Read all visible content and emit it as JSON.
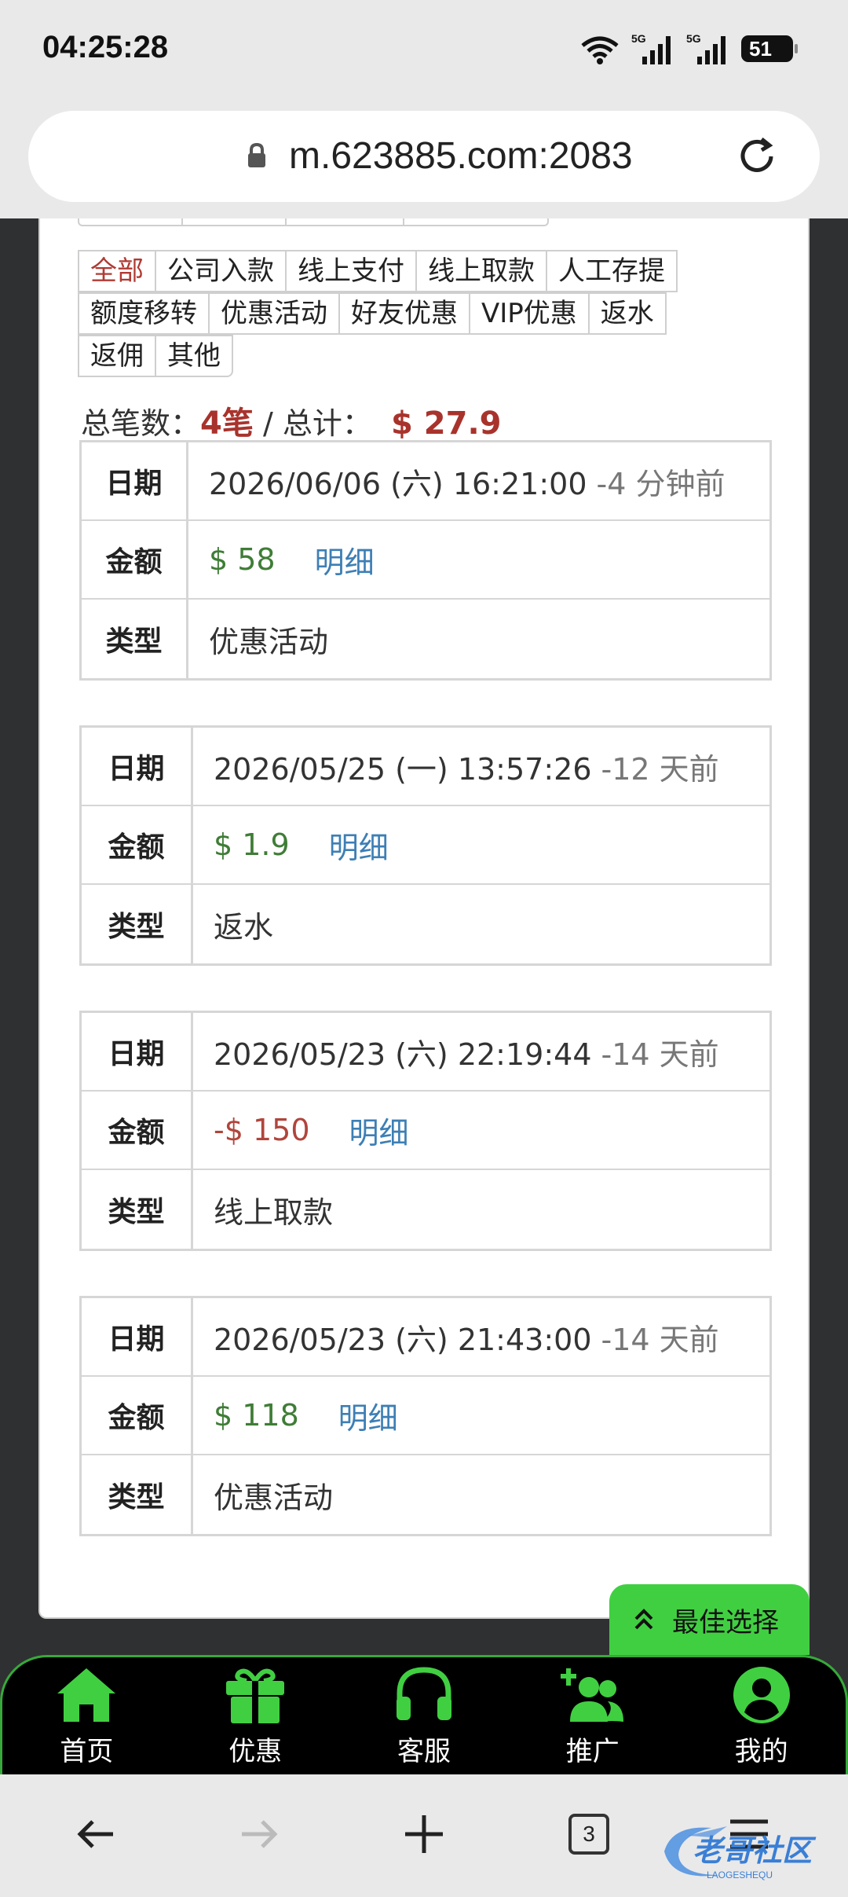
{
  "status_bar": {
    "time": "04:25:28",
    "battery": "51"
  },
  "browser": {
    "url": "m.623885.com:2083",
    "tab_count": "3"
  },
  "filters": {
    "row1": [
      "全部",
      "公司入款",
      "线上支付",
      "线上取款",
      "人工存提"
    ],
    "row2": [
      "额度移转",
      "优惠活动",
      "好友优惠",
      "VIP优惠",
      "返水"
    ],
    "row3": [
      "返佣",
      "其他"
    ],
    "active": "全部"
  },
  "summary": {
    "count_label": "总笔数：",
    "count_value": "4笔",
    "separator": " / ",
    "total_label": "总计：",
    "total_value": "$ 27.9"
  },
  "labels": {
    "date": "日期",
    "amount": "金额",
    "type": "类型",
    "detail": "明细"
  },
  "records": [
    {
      "date": "2026/06/06 (六) 16:21:00",
      "ago": "-4 分钟前",
      "amount": "$ 58",
      "type": "优惠活动"
    },
    {
      "date": "2026/05/25 (一) 13:57:26",
      "ago": "-12 天前",
      "amount": "$ 1.9",
      "type": "返水"
    },
    {
      "date": "2026/05/23 (六) 22:19:44",
      "ago": "-14 天前",
      "amount": "-$ 150",
      "type": "线上取款"
    },
    {
      "date": "2026/05/23 (六) 21:43:00",
      "ago": "-14 天前",
      "amount": "$ 118",
      "type": "优惠活动"
    }
  ],
  "best_choice": "最佳选择",
  "nav": [
    {
      "label": "首页",
      "icon": "home-icon"
    },
    {
      "label": "优惠",
      "icon": "gift-icon"
    },
    {
      "label": "客服",
      "icon": "headset-icon"
    },
    {
      "label": "推广",
      "icon": "add-user-icon"
    },
    {
      "label": "我的",
      "icon": "profile-icon"
    }
  ],
  "colors": {
    "accent_green": "#41cf42",
    "positive": "#3f7d36",
    "negative": "#b0453c",
    "link": "#3d7fb5",
    "active_tab": "#b03a33"
  }
}
